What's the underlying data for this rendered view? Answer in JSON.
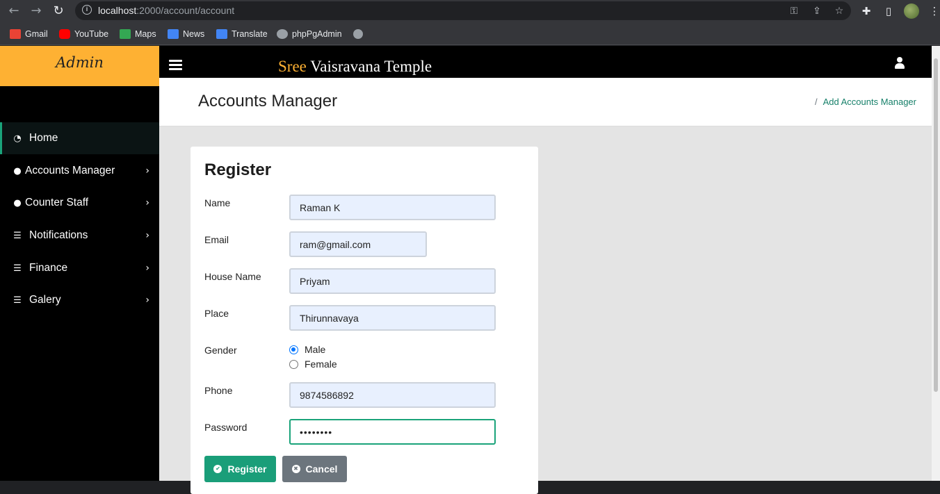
{
  "browser": {
    "url_host": "localhost",
    "url_path": ":2000/account/account",
    "bookmarks": [
      {
        "label": "Gmail",
        "color": "#ea4335"
      },
      {
        "label": "YouTube",
        "color": "#ff0000"
      },
      {
        "label": "Maps",
        "color": "#34a853"
      },
      {
        "label": "News",
        "color": "#4285f4"
      },
      {
        "label": "Translate",
        "color": "#4285f4"
      },
      {
        "label": "phpPgAdmin",
        "color": "#9aa0a6"
      }
    ]
  },
  "sidebar": {
    "brand": "Admin",
    "items": [
      {
        "label": "Home",
        "icon": "dashboard-icon"
      },
      {
        "label": "Accounts Manager",
        "icon": "user-icon"
      },
      {
        "label": "Counter Staff",
        "icon": "user-icon"
      },
      {
        "label": "Notifications",
        "icon": "list-icon"
      },
      {
        "label": "Finance",
        "icon": "list-icon"
      },
      {
        "label": "Galery",
        "icon": "list-icon"
      }
    ]
  },
  "topbar": {
    "title_accent": "Sree",
    "title_rest": " Vaisravana Temple"
  },
  "header": {
    "page_title": "Accounts Manager",
    "breadcrumb_sep": "/",
    "breadcrumb_link": "Add Accounts Manager"
  },
  "form": {
    "title": "Register",
    "name_label": "Name",
    "name_value": "Raman K",
    "email_label": "Email",
    "email_value": "ram@gmail.com",
    "house_label": "House Name",
    "house_value": "Priyam",
    "place_label": "Place",
    "place_value": "Thirunnavaya",
    "gender_label": "Gender",
    "gender_male": "Male",
    "gender_female": "Female",
    "phone_label": "Phone",
    "phone_value": "9874586892",
    "password_label": "Password",
    "password_value": "••••••••",
    "register_label": "Register",
    "cancel_label": "Cancel"
  },
  "colors": {
    "accent": "#1aa37a",
    "brand": "#feb133",
    "sidebar_bg": "#000000"
  }
}
